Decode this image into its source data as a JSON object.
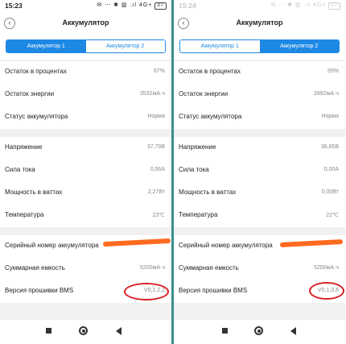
{
  "left": {
    "status": {
      "time": "15:23",
      "icons": "✉ ⋯  ✱ ▥ .ıl 4G+",
      "battery": "37"
    },
    "title": "Аккумулятор",
    "tabs": [
      {
        "label": "Аккумулятор 1",
        "active": true
      },
      {
        "label": "Аккумулятор 2",
        "active": false
      }
    ],
    "group1": [
      {
        "label": "Остаток в процентах",
        "value": "67%"
      },
      {
        "label": "Остаток энергии",
        "value": "3532мА·ч"
      },
      {
        "label": "Статус аккумулятора",
        "value": "Норма"
      }
    ],
    "group2": [
      {
        "label": "Напряжение",
        "value": "37,79В"
      },
      {
        "label": "Сила тока",
        "value": "0,06А"
      },
      {
        "label": "Мощность в ваттах",
        "value": "2,27Вт"
      },
      {
        "label": "Температура",
        "value": "23℃"
      }
    ],
    "group3": [
      {
        "label": "Серийный номер аккумулятора",
        "value": ""
      },
      {
        "label": "Суммарная емкость",
        "value": "5200мА·ч"
      },
      {
        "label": "Версия прошивки BMS",
        "value": "V0,1,2,2"
      }
    ]
  },
  "right": {
    "status": {
      "time": "15:24",
      "icons": "✉ ⋯  ✱ ▥ .ıl 4G+",
      "battery": "37"
    },
    "title": "Аккумулятор",
    "tabs": [
      {
        "label": "Аккумулятор 1",
        "active": false
      },
      {
        "label": "Аккумулятор 2",
        "active": true
      }
    ],
    "group1": [
      {
        "label": "Остаток в процентах",
        "value": "55%"
      },
      {
        "label": "Остаток энергии",
        "value": "2892мА·ч"
      },
      {
        "label": "Статус аккумулятора",
        "value": "Норма"
      }
    ],
    "group2": [
      {
        "label": "Напряжение",
        "value": "36,85В"
      },
      {
        "label": "Сила тока",
        "value": "0,00А"
      },
      {
        "label": "Мощность в ваттах",
        "value": "0,00Вт"
      },
      {
        "label": "Температура",
        "value": "22℃"
      }
    ],
    "group3": [
      {
        "label": "Серийный номер аккумулятора",
        "value": ""
      },
      {
        "label": "Суммарная емкость",
        "value": "5200мА·ч"
      },
      {
        "label": "Версия прошивки BMS",
        "value": "V0,1,3,6"
      }
    ]
  },
  "colors": {
    "accent": "#1e88e5",
    "annotation": "#d81f26",
    "redaction": "#ff6a1f",
    "divider": "#3a8f8a"
  },
  "icons": {
    "back": "chevron-left-icon",
    "nav": [
      "recents-square-icon",
      "home-circle-icon",
      "back-triangle-icon"
    ]
  }
}
